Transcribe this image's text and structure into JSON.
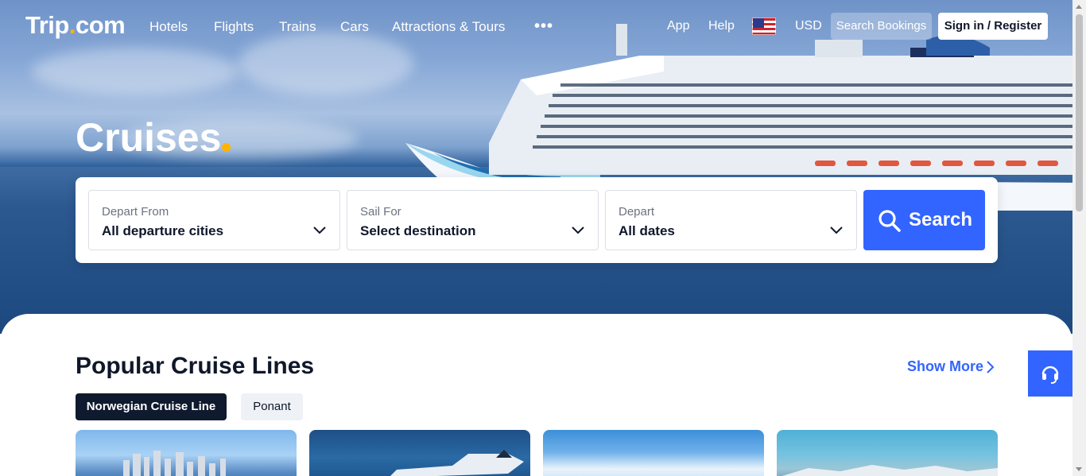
{
  "nav": {
    "logo_text": "Trip",
    "logo_dot": ".",
    "logo_suffix": "com",
    "links": [
      "Hotels",
      "Flights",
      "Trains",
      "Cars",
      "Attractions & Tours"
    ],
    "more": "•••",
    "app": "App",
    "help": "Help",
    "currency": "USD",
    "search_bookings": "Search Bookings",
    "sign_in": "Sign in / Register"
  },
  "hero": {
    "title": "Cruises"
  },
  "search": {
    "fields": [
      {
        "label": "Depart From",
        "value": "All departure cities"
      },
      {
        "label": "Sail For",
        "value": "Select destination"
      },
      {
        "label": "Depart",
        "value": "All dates"
      }
    ],
    "button": "Search"
  },
  "popular": {
    "title": "Popular Cruise Lines",
    "show_more": "Show More",
    "tabs": [
      "Norwegian Cruise Line",
      "Ponant"
    ]
  },
  "colors": {
    "accent": "#3264ff",
    "brand_dot": "#ffb400",
    "dark": "#0f1a2e"
  }
}
